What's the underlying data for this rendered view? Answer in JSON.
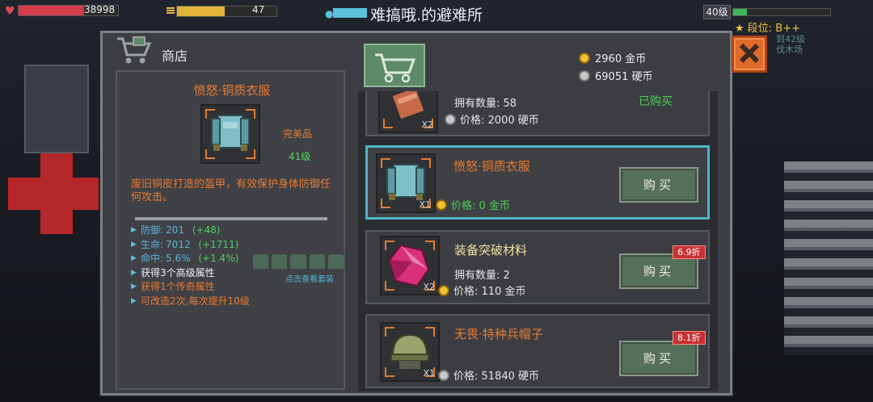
{
  "hud": {
    "hp_value": "38998",
    "hp_fill": 0.66,
    "energy_value": "47",
    "energy_fill": 0.48,
    "shelter_title": "难搞哦.的避难所",
    "level_label": "40级",
    "xp_fill": 0.14,
    "rank_label": "段位: B++",
    "ghost_line1": "到42级",
    "ghost_line2": "伐木场"
  },
  "shop": {
    "title": "商店",
    "icon": "shopping-cart-icon",
    "gold_text": "2960 金币",
    "silver_text": "69051 硬币"
  },
  "detail": {
    "name": "愤怒·铜质衣服",
    "quality": "完美品",
    "level": "41级",
    "description": "废旧铜皮打造的盔甲，有效保护身体防御任何攻击。",
    "stats": [
      {
        "label": "防御: ",
        "value": "201",
        "bonus": "(+48)"
      },
      {
        "label": "生命: ",
        "value": "7012",
        "bonus": "(+1711)"
      },
      {
        "label": "命中: ",
        "value": "5.6%",
        "bonus": "(+1.4%)"
      }
    ],
    "extras": [
      "获得3个高级属性",
      "获得1个传奇属性",
      "可改造2次,每次提升10级"
    ],
    "set_link": "点击查看套装"
  },
  "items": [
    {
      "name": "",
      "line1": "拥有数量: 58",
      "line2": "价格: 2000 硬币",
      "currency": "silver",
      "qty": "X2",
      "status": "已购买",
      "icon": "copper-plate-icon"
    },
    {
      "name": "愤怒·铜质衣服",
      "line1": "",
      "line2": "价格: 0 金币",
      "currency": "gold",
      "qty": "X1",
      "button": "购买",
      "icon": "armor-icon"
    },
    {
      "name": "装备突破材料",
      "line1": "拥有数量: 2",
      "line2": "价格: 110 金币",
      "currency": "gold",
      "qty": "X2",
      "button": "购买",
      "badge": "6.9折",
      "icon": "red-crystal-icon"
    },
    {
      "name": "无畏·特种兵帽子",
      "line1": "",
      "line2": "价格: 51840 硬币",
      "currency": "silver",
      "qty": "X1",
      "button": "购买",
      "badge": "8.1折",
      "icon": "helmet-icon"
    }
  ],
  "colors": {
    "accent_orange": "#ec7a32",
    "accent_green": "#4fcf5a",
    "selected_border": "#4fb4c6",
    "badge_red": "#c73234"
  }
}
